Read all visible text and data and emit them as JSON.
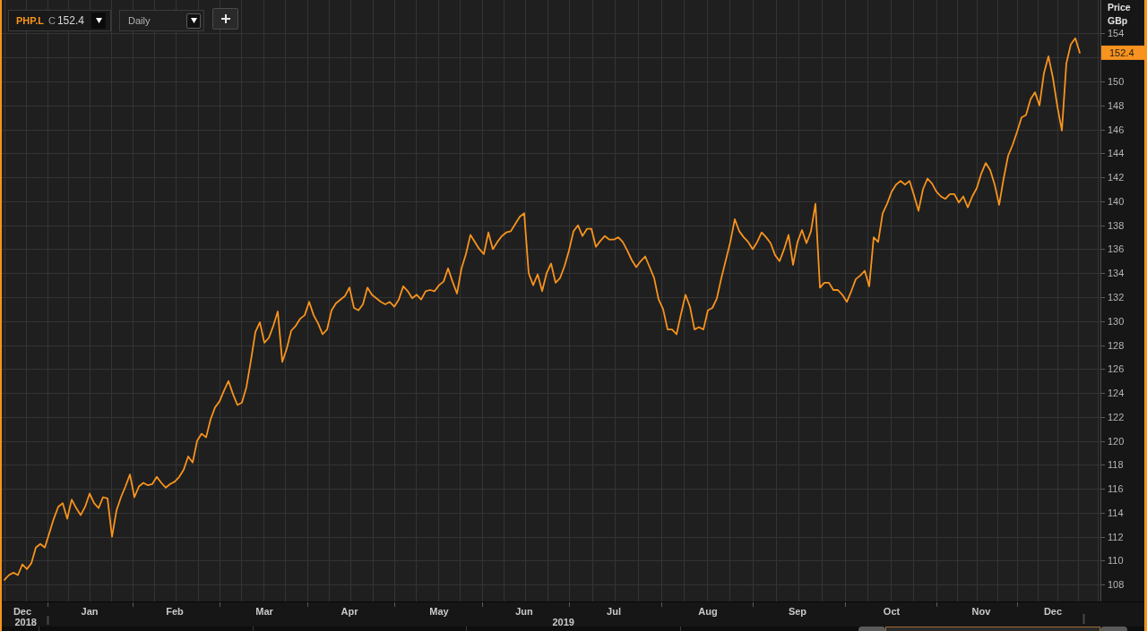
{
  "toolbar": {
    "instrument": {
      "symbol": "PHP.L",
      "price_label": "C",
      "price": "152.4"
    },
    "interval": {
      "value": "Daily"
    }
  },
  "price_chart": {
    "unit": "GBp",
    "last_price": "152.4",
    "chart_data": {
      "type": "line",
      "ylabel": "Price",
      "grid": true,
      "categories": [
        null,
        null,
        null,
        null,
        "Dec",
        null,
        null,
        null,
        null,
        null,
        null,
        null,
        null,
        null,
        null,
        null,
        null,
        null,
        null,
        "Jan",
        null,
        null,
        null,
        null,
        null,
        null,
        null,
        null,
        null,
        null,
        null,
        null,
        null,
        null,
        null,
        null,
        null,
        null,
        "Feb",
        null,
        null,
        null,
        null,
        null,
        null,
        null,
        null,
        null,
        null,
        null,
        null,
        null,
        null,
        null,
        null,
        null,
        null,
        null,
        "Mar",
        null,
        null,
        null,
        null,
        null,
        null,
        null,
        null,
        null,
        null,
        null,
        null,
        null,
        null,
        null,
        null,
        null,
        null,
        "Apr",
        null,
        null,
        null,
        null,
        null,
        null,
        null,
        null,
        null,
        null,
        null,
        null,
        null,
        null,
        null,
        null,
        null,
        null,
        null,
        "May",
        null,
        null,
        null,
        null,
        null,
        null,
        null,
        null,
        null,
        null,
        null,
        null,
        null,
        null,
        null,
        null,
        null,
        null,
        "Jun",
        null,
        null,
        null,
        null,
        null,
        null,
        null,
        null,
        null,
        null,
        null,
        null,
        null,
        null,
        null,
        null,
        null,
        null,
        null,
        "Jul",
        null,
        null,
        null,
        null,
        null,
        null,
        null,
        null,
        null,
        null,
        null,
        null,
        null,
        null,
        null,
        null,
        null,
        null,
        null,
        null,
        "Aug",
        null,
        null,
        null,
        null,
        null,
        null,
        null,
        null,
        null,
        null,
        null,
        null,
        null,
        null,
        null,
        null,
        null,
        null,
        null,
        "Sep",
        null,
        null,
        null,
        null,
        null,
        null,
        null,
        null,
        null,
        null,
        null,
        null,
        null,
        null,
        null,
        null,
        null,
        null,
        null,
        null,
        "Oct",
        null,
        null,
        null,
        null,
        null,
        null,
        null,
        null,
        null,
        null,
        null,
        null,
        null,
        null,
        null,
        null,
        null,
        null,
        null,
        "Nov",
        null,
        null,
        null,
        null,
        null,
        null,
        null,
        null,
        null,
        null,
        null,
        null,
        null,
        null,
        null,
        "Dec",
        null,
        null,
        null,
        null,
        null,
        null
      ],
      "series": [
        {
          "color": "#f7931e",
          "values": [
            108.4,
            108.8,
            109.0,
            108.8,
            109.7,
            109.3,
            109.8,
            111.1,
            111.4,
            111.1,
            112.3,
            113.5,
            114.5,
            114.8,
            113.5,
            115.1,
            114.4,
            113.8,
            114.5,
            115.6,
            114.8,
            114.4,
            115.3,
            115.2,
            112.0,
            114.2,
            115.3,
            116.2,
            117.2,
            115.3,
            116.2,
            116.5,
            116.3,
            116.4,
            117.0,
            116.5,
            116.1,
            116.4,
            116.6,
            117.0,
            117.6,
            118.7,
            118.2,
            120.0,
            120.6,
            120.3,
            121.8,
            122.8,
            123.3,
            124.2,
            125.0,
            123.9,
            123.0,
            123.2,
            124.5,
            126.7,
            129.1,
            129.9,
            128.2,
            128.6,
            129.6,
            130.8,
            126.6,
            127.7,
            129.2,
            129.6,
            130.2,
            130.5,
            131.6,
            130.5,
            129.8,
            128.9,
            129.3,
            130.9,
            131.5,
            131.8,
            132.1,
            132.8,
            131.1,
            130.9,
            131.4,
            132.8,
            132.2,
            131.9,
            131.6,
            131.4,
            131.6,
            131.2,
            131.8,
            132.9,
            132.5,
            131.9,
            132.2,
            131.8,
            132.5,
            132.6,
            132.5,
            133.0,
            133.3,
            134.4,
            133.3,
            132.3,
            134.4,
            135.6,
            137.2,
            136.6,
            136.0,
            135.6,
            137.4,
            136.0,
            136.6,
            137.1,
            137.4,
            137.5,
            138.1,
            138.7,
            139.0,
            134.0,
            133.0,
            133.9,
            132.5,
            134.0,
            134.8,
            133.2,
            133.6,
            134.6,
            135.9,
            137.5,
            138.0,
            137.1,
            137.7,
            137.7,
            136.2,
            136.7,
            137.1,
            136.8,
            136.8,
            137.0,
            136.6,
            135.9,
            135.1,
            134.5,
            135.0,
            135.4,
            134.5,
            133.6,
            131.8,
            131.0,
            129.3,
            129.3,
            128.9,
            130.6,
            132.2,
            131.2,
            129.3,
            129.5,
            129.3,
            130.9,
            131.1,
            131.9,
            133.6,
            135.1,
            136.6,
            138.5,
            137.5,
            137.0,
            136.6,
            136.0,
            136.6,
            137.4,
            137.0,
            136.5,
            135.5,
            135.0,
            136.0,
            137.2,
            134.7,
            136.6,
            137.6,
            136.5,
            137.5,
            139.8,
            132.8,
            133.2,
            133.2,
            132.6,
            132.6,
            132.2,
            131.6,
            132.5,
            133.5,
            133.8,
            134.2,
            132.9,
            137.0,
            136.6,
            139.0,
            139.8,
            140.8,
            141.4,
            141.7,
            141.4,
            141.7,
            140.5,
            139.2,
            141.0,
            141.9,
            141.5,
            140.8,
            140.4,
            140.2,
            140.6,
            140.6,
            139.9,
            140.4,
            139.5,
            140.4,
            141.1,
            142.3,
            143.2,
            142.6,
            141.4,
            139.7,
            141.9,
            143.8,
            144.7,
            145.8,
            147.0,
            147.2,
            148.5,
            149.1,
            148.0,
            150.7,
            152.1,
            150.3,
            147.9,
            145.9,
            151.5,
            153.1,
            153.6,
            152.4
          ]
        }
      ],
      "ylim": [
        106.6,
        156.8
      ],
      "yticks": [
        108,
        110,
        112,
        114,
        116,
        118,
        120,
        122,
        124,
        126,
        128,
        130,
        132,
        134,
        136,
        138,
        140,
        142,
        144,
        146,
        148,
        150,
        154
      ],
      "annotations": [
        "2018",
        "2019"
      ]
    }
  }
}
